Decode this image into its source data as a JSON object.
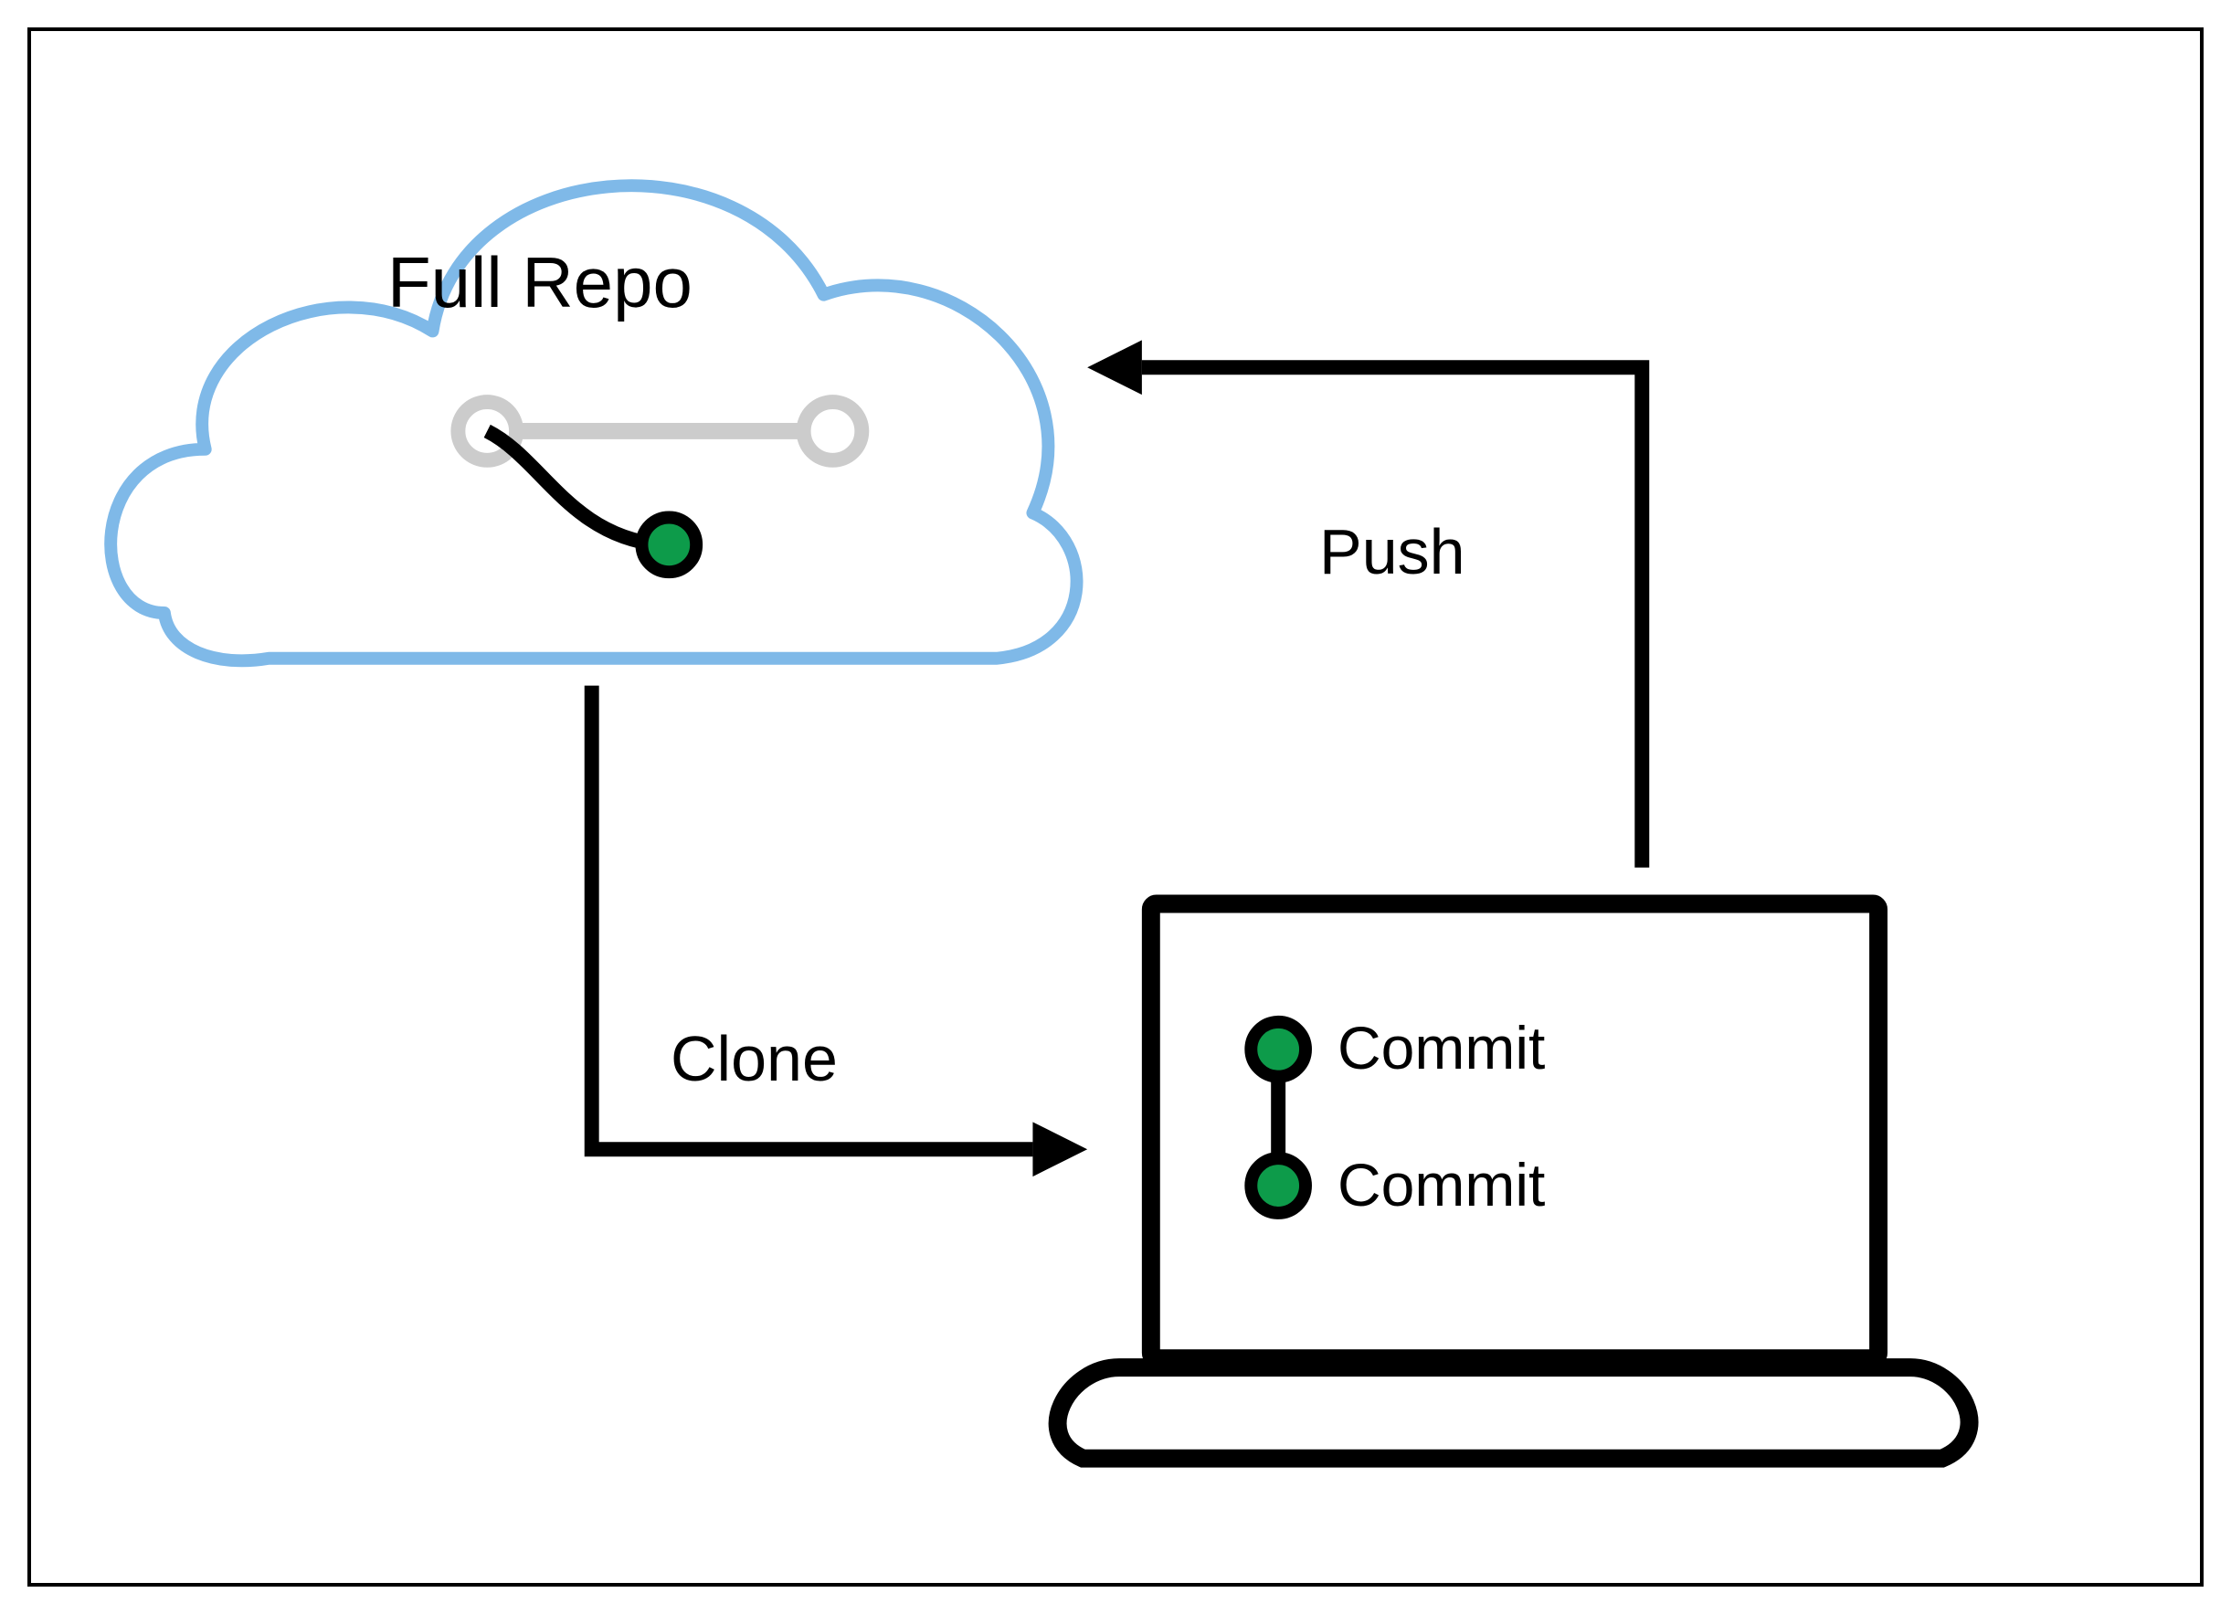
{
  "cloud": {
    "title": "Full Repo"
  },
  "arrows": {
    "clone": "Clone",
    "push": "Push"
  },
  "laptop": {
    "commit1": "Commit",
    "commit2": "Commit"
  },
  "colors": {
    "cloud_stroke": "#7fb9e8",
    "commit_dot": "#0d9b4a",
    "faded": "#cccccc",
    "line": "#000000"
  }
}
